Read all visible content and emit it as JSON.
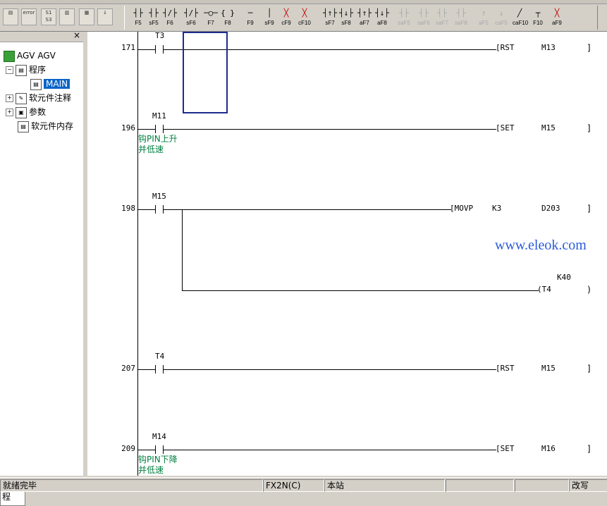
{
  "toolbar": {
    "buttons": [
      {
        "label": "F5",
        "glyph": "┤├"
      },
      {
        "label": "sF5",
        "glyph": "┤├"
      },
      {
        "label": "F6",
        "glyph": "┤/├"
      },
      {
        "label": "sF6",
        "glyph": "┤/├"
      },
      {
        "label": "F7",
        "glyph": "─○─"
      },
      {
        "label": "F8",
        "glyph": "{ }"
      },
      {
        "label": "F9",
        "glyph": "─"
      },
      {
        "label": "sF9",
        "glyph": "│"
      },
      {
        "label": "cF9",
        "glyph": "╳"
      },
      {
        "label": "cF10",
        "glyph": "╳"
      },
      {
        "label": "sF7",
        "glyph": "┤↑├"
      },
      {
        "label": "sF8",
        "glyph": "┤↓├"
      },
      {
        "label": "aF7",
        "glyph": "┤↑├"
      },
      {
        "label": "aF8",
        "glyph": "┤↓├"
      },
      {
        "label": "saF5",
        "glyph": "┤├"
      },
      {
        "label": "saF6",
        "glyph": "┤├"
      },
      {
        "label": "saF7",
        "glyph": "┤├"
      },
      {
        "label": "saF8",
        "glyph": "┤├"
      },
      {
        "label": "aF5",
        "glyph": "↑"
      },
      {
        "label": "caF5",
        "glyph": "↓"
      },
      {
        "label": "caF10",
        "glyph": "╱"
      },
      {
        "label": "F10",
        "glyph": "┬"
      },
      {
        "label": "aF9",
        "glyph": "╳"
      }
    ]
  },
  "tree": {
    "root": "AGV AGV",
    "program": "程序",
    "main": "MAIN",
    "comments": "软元件注释",
    "params": "参数",
    "memory": "软元件内存",
    "tab": "程"
  },
  "ladder": {
    "rungs": [
      {
        "step": "171",
        "contact": "T3",
        "instr": "RST",
        "operand": "M13",
        "comment": ""
      },
      {
        "step": "196",
        "contact": "M11",
        "instr": "SET",
        "operand": "M15",
        "comment": "钩PIN上升\n并低速"
      },
      {
        "step": "198",
        "contact": "M15",
        "instr": "MOVP",
        "operand": "K3",
        "operand2": "D203",
        "coil": "T4",
        "coil_k": "K40",
        "comment": ""
      },
      {
        "step": "207",
        "contact": "T4",
        "instr": "RST",
        "operand": "M15",
        "comment": ""
      },
      {
        "step": "209",
        "contact": "M14",
        "instr": "SET",
        "operand": "M16",
        "comment": "钩PIN下降\n并低速"
      }
    ],
    "watermark": "www.eleok.com"
  },
  "status": {
    "msg": "就绪完毕",
    "plc": "FX2N(C)",
    "station": "本站",
    "mode": "改写"
  }
}
